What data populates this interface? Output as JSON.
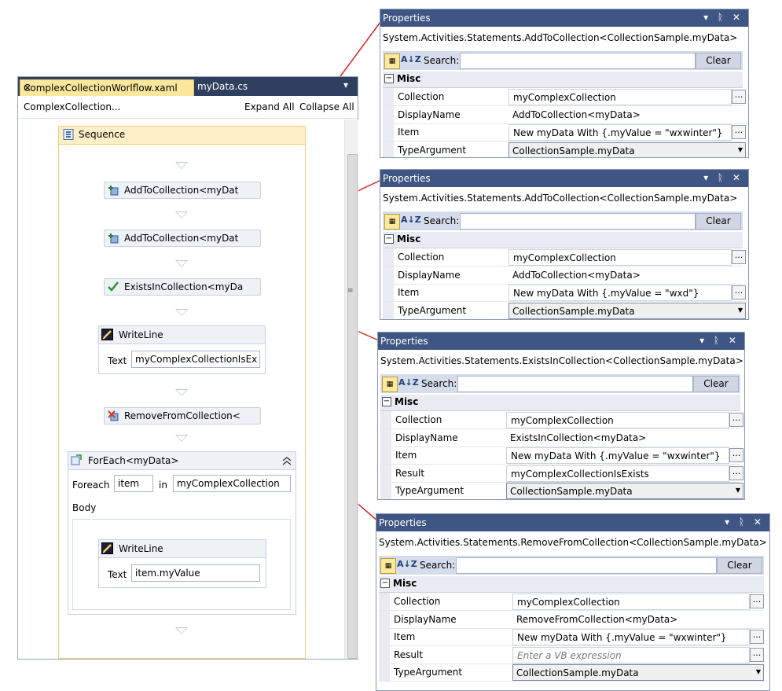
{
  "designer": {
    "tabs": [
      {
        "label": "ComplexCollectionWorlflow.xaml",
        "close": "✕"
      },
      {
        "label": "myData.cs"
      }
    ],
    "tab_menu": "▾",
    "breadcrumb": "ComplexCollection...",
    "expand_all": "Expand All",
    "collapse_all": "Collapse All",
    "sequence_label": "Sequence",
    "activities": {
      "add1": "AddToCollection<myDat",
      "add2": "AddToCollection<myDat",
      "exists": "ExistsInCollection<myDa",
      "writeline1": {
        "title": "WriteLine",
        "text_label": "Text",
        "text_value": "myComplexCollectionIsExis"
      },
      "remove": "RemoveFromCollection<",
      "foreach": {
        "title": "ForEach<myData>",
        "foreach_label": "Foreach",
        "item_value": "item",
        "in_label": "in",
        "collection_value": "myComplexCollection",
        "body_label": "Body",
        "writeline": {
          "title": "WriteLine",
          "text_label": "Text",
          "text_value": "item.myValue"
        }
      }
    }
  },
  "properties_common": {
    "title": "Properties",
    "title_buttons": "▾ ᚱ ✕",
    "search_label": "Search:",
    "clear_label": "Clear",
    "category": "Misc",
    "category_toggle": "⊟",
    "ellipsis": "...",
    "dropdown_arrow": "▼"
  },
  "panels": [
    {
      "class_name": "System.Activities.Statements.AddToCollection<CollectionSample.myData>",
      "rows": [
        {
          "name": "Collection",
          "value": "myComplexCollection",
          "kind": "ellipsis"
        },
        {
          "name": "DisplayName",
          "value": "AddToCollection<myData>",
          "kind": "text"
        },
        {
          "name": "Item",
          "value": "New myData With {.myValue = \"wxwinter\"}",
          "kind": "ellipsis"
        },
        {
          "name": "TypeArgument",
          "value": "CollectionSample.myData",
          "kind": "dropdown"
        }
      ]
    },
    {
      "class_name": "System.Activities.Statements.AddToCollection<CollectionSample.myData>",
      "rows": [
        {
          "name": "Collection",
          "value": "myComplexCollection",
          "kind": "ellipsis"
        },
        {
          "name": "DisplayName",
          "value": "AddToCollection<myData>",
          "kind": "text"
        },
        {
          "name": "Item",
          "value": "New myData With {.myValue = \"wxd\"}",
          "kind": "ellipsis"
        },
        {
          "name": "TypeArgument",
          "value": "CollectionSample.myData",
          "kind": "dropdown"
        }
      ]
    },
    {
      "class_name": "System.Activities.Statements.ExistsInCollection<CollectionSample.myData>",
      "rows": [
        {
          "name": "Collection",
          "value": "myComplexCollection",
          "kind": "ellipsis"
        },
        {
          "name": "DisplayName",
          "value": "ExistsInCollection<myData>",
          "kind": "text"
        },
        {
          "name": "Item",
          "value": "New myData With {.myValue = \"wxwinter\"}",
          "kind": "ellipsis"
        },
        {
          "name": "Result",
          "value": "myComplexCollectionIsExists",
          "kind": "ellipsis"
        },
        {
          "name": "TypeArgument",
          "value": "CollectionSample.myData",
          "kind": "dropdown"
        }
      ]
    },
    {
      "class_name": "System.Activities.Statements.RemoveFromCollection<CollectionSample.myData>",
      "rows": [
        {
          "name": "Collection",
          "value": "myComplexCollection",
          "kind": "ellipsis"
        },
        {
          "name": "DisplayName",
          "value": "RemoveFromCollection<myData>",
          "kind": "text"
        },
        {
          "name": "Item",
          "value": "New myData With {.myValue = \"wxwinter\"}",
          "kind": "ellipsis"
        },
        {
          "name": "Result",
          "value": "Enter a VB expression",
          "kind": "placeholder"
        },
        {
          "name": "TypeArgument",
          "value": "CollectionSample.myData",
          "kind": "dropdown"
        }
      ]
    }
  ]
}
